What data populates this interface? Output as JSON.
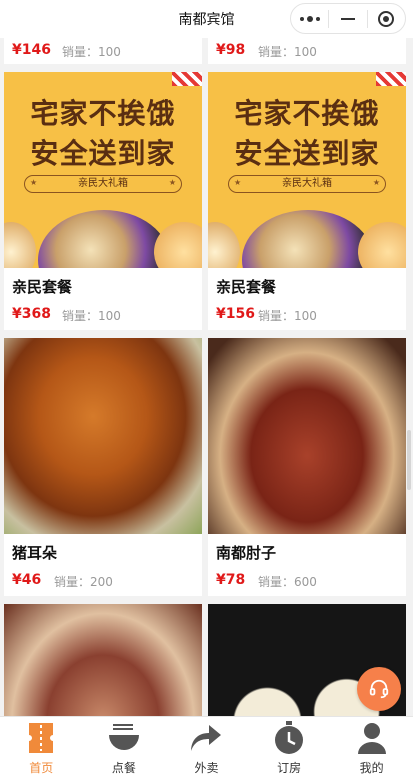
{
  "nav": {
    "title": "南都宾馆"
  },
  "products": {
    "sales_prefix": "销量：",
    "rows": [
      [
        {
          "price": "¥146",
          "sales": "100"
        },
        {
          "price": "¥98",
          "sales": "100"
        }
      ],
      [
        {
          "name": "亲民套餐",
          "price": "¥368",
          "sales": "100",
          "poster": {
            "line1": "宅家不挨饿",
            "line2": "安全送到家",
            "ribbon": "亲民大礼箱"
          }
        },
        {
          "name": "亲民套餐",
          "price": "¥156",
          "sales": "100",
          "poster": {
            "line1": "宅家不挨饿",
            "line2": "安全送到家",
            "ribbon": "亲民大礼箱"
          }
        }
      ],
      [
        {
          "name": "猪耳朵",
          "price": "¥46",
          "sales": "200"
        },
        {
          "name": "南都肘子",
          "price": "¥78",
          "sales": "600"
        }
      ]
    ]
  },
  "tabs": [
    {
      "label": "首页",
      "icon": "ticket-icon",
      "active": true
    },
    {
      "label": "点餐",
      "icon": "bowl-icon",
      "active": false
    },
    {
      "label": "外卖",
      "icon": "forward-arrow-icon",
      "active": false
    },
    {
      "label": "订房",
      "icon": "clock-icon",
      "active": false
    },
    {
      "label": "我的",
      "icon": "user-icon",
      "active": false
    }
  ],
  "colors": {
    "accent": "#f08a3a",
    "price": "#e01919",
    "service": "#f6804a"
  }
}
